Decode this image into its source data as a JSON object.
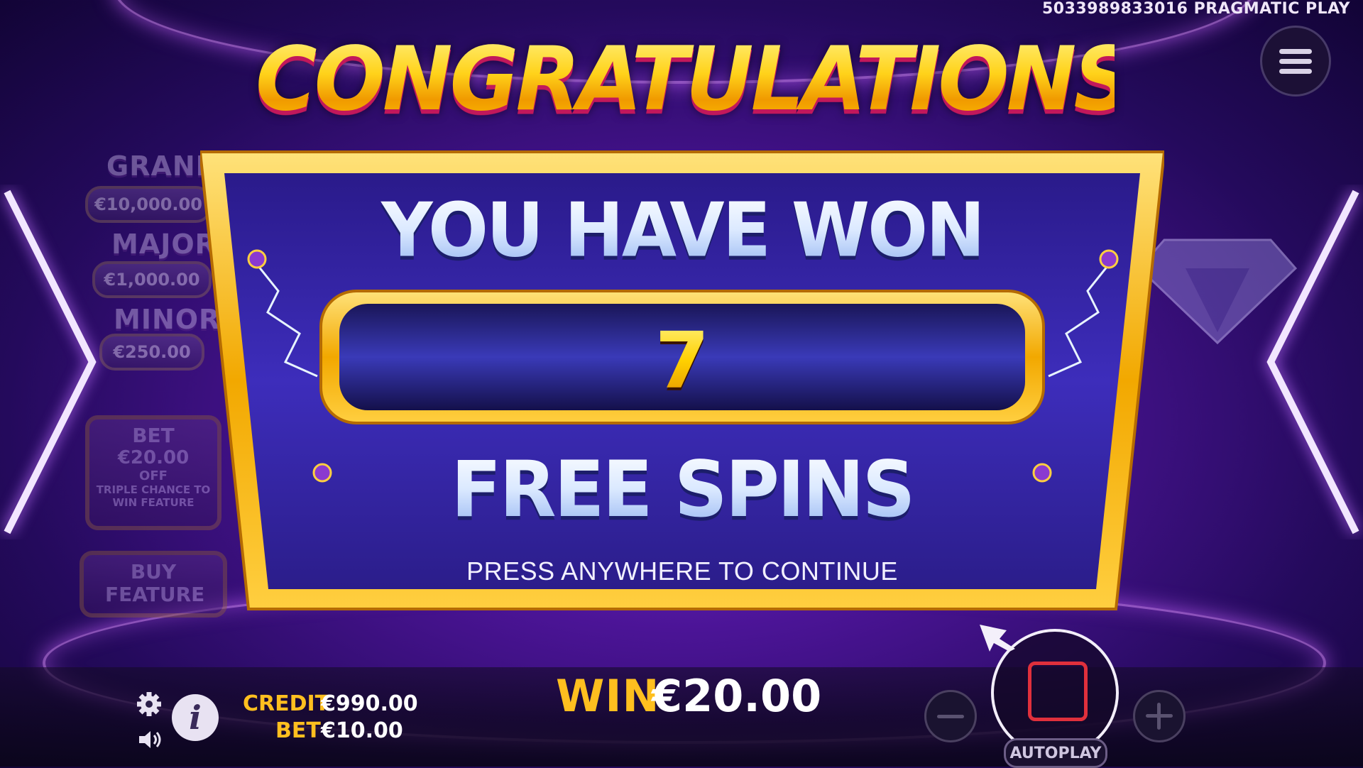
{
  "header": {
    "game_id": "5033989833016",
    "provider": "PRAGMATIC PLAY"
  },
  "popup": {
    "headline": "CONGRATULATIONS",
    "you_have_won": "YOU HAVE WON",
    "spins_count": "7",
    "free_spins": "FREE SPINS",
    "continue_hint": "PRESS ANYWHERE TO CONTINUE"
  },
  "jackpots": [
    {
      "name": "GRAND",
      "value": "€10,000.00"
    },
    {
      "name": "MAJOR",
      "value": "€1,000.00"
    },
    {
      "name": "MINOR",
      "value": "€250.00"
    }
  ],
  "side_panel": {
    "bet_label": "BET",
    "bet_value": "€20.00",
    "toggle_state": "OFF",
    "triple_chance": "TRIPLE CHANCE TO WIN FEATURE",
    "buy_feature": "BUY FEATURE"
  },
  "bottom_bar": {
    "credit_label": "CREDIT",
    "credit_value": "€990.00",
    "bet_label": "BET",
    "bet_value": "€10.00",
    "win_label": "WIN",
    "win_value": "€20.00",
    "autoplay_label": "AUTOPLAY"
  },
  "icons": {
    "settings": "gear-icon",
    "info": "info-icon",
    "sound": "speaker-icon",
    "menu": "hamburger-icon",
    "minus": "minus-icon",
    "plus": "plus-icon",
    "stop": "stop-icon"
  },
  "colors": {
    "gold": "#ffbf1f",
    "purple_bg": "#4b1496",
    "stop_red": "#e0303c"
  }
}
